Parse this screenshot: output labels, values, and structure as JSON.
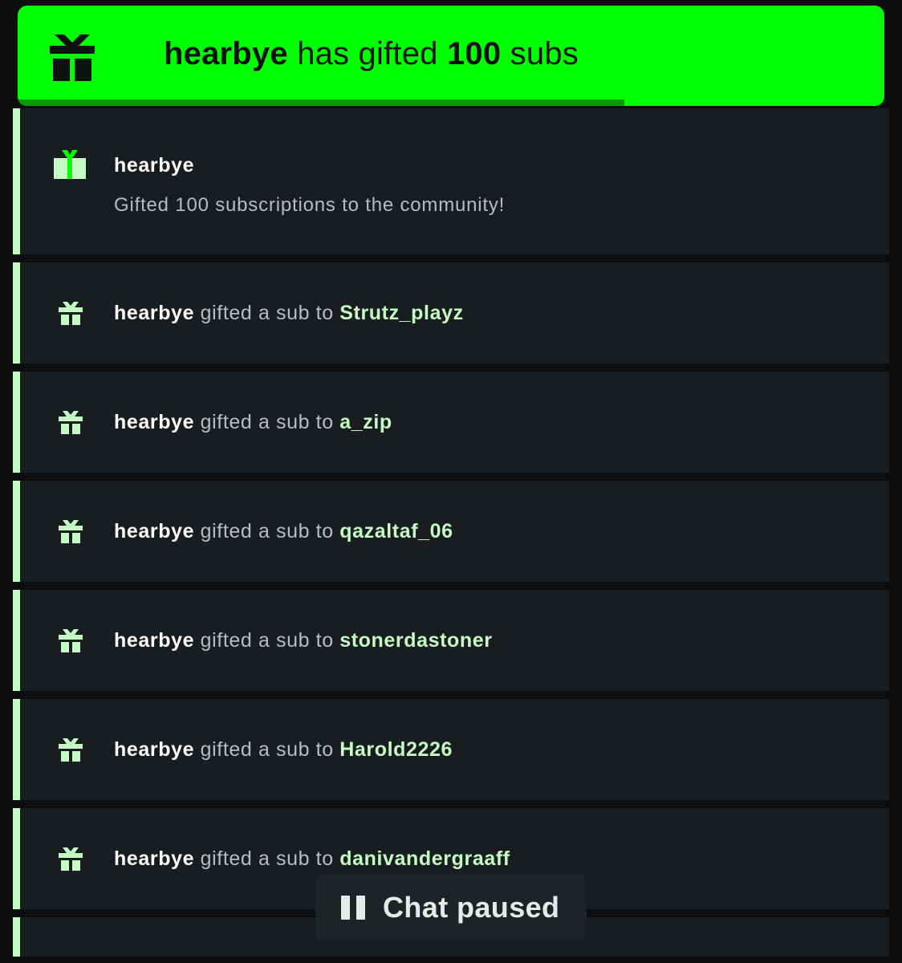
{
  "banner": {
    "user": "hearbye",
    "middle": "has gifted",
    "count": "100",
    "suffix": "subs",
    "progress_percent": 70
  },
  "header_event": {
    "user": "hearbye",
    "description": "Gifted 100 subscriptions to the community!"
  },
  "gift_rows": [
    {
      "gifter": "hearbye",
      "verb": "gifted a sub to",
      "recipient": "Strutz_playz"
    },
    {
      "gifter": "hearbye",
      "verb": "gifted a sub to",
      "recipient": "a_zip"
    },
    {
      "gifter": "hearbye",
      "verb": "gifted a sub to",
      "recipient": "qazaltaf_06"
    },
    {
      "gifter": "hearbye",
      "verb": "gifted a sub to",
      "recipient": "stonerdastoner"
    },
    {
      "gifter": "hearbye",
      "verb": "gifted a sub to",
      "recipient": "Harold2226"
    },
    {
      "gifter": "hearbye",
      "verb": "gifted a sub to",
      "recipient": "danivandergraaff"
    }
  ],
  "paused": {
    "label": "Chat paused",
    "icon": "pause-icon"
  },
  "colors": {
    "banner": "#00ff00",
    "banner_progress": "#0a9a0a",
    "row_bg": "#191d1f",
    "accent": "#c4fcc4",
    "page_bg": "#0b0d0e"
  }
}
